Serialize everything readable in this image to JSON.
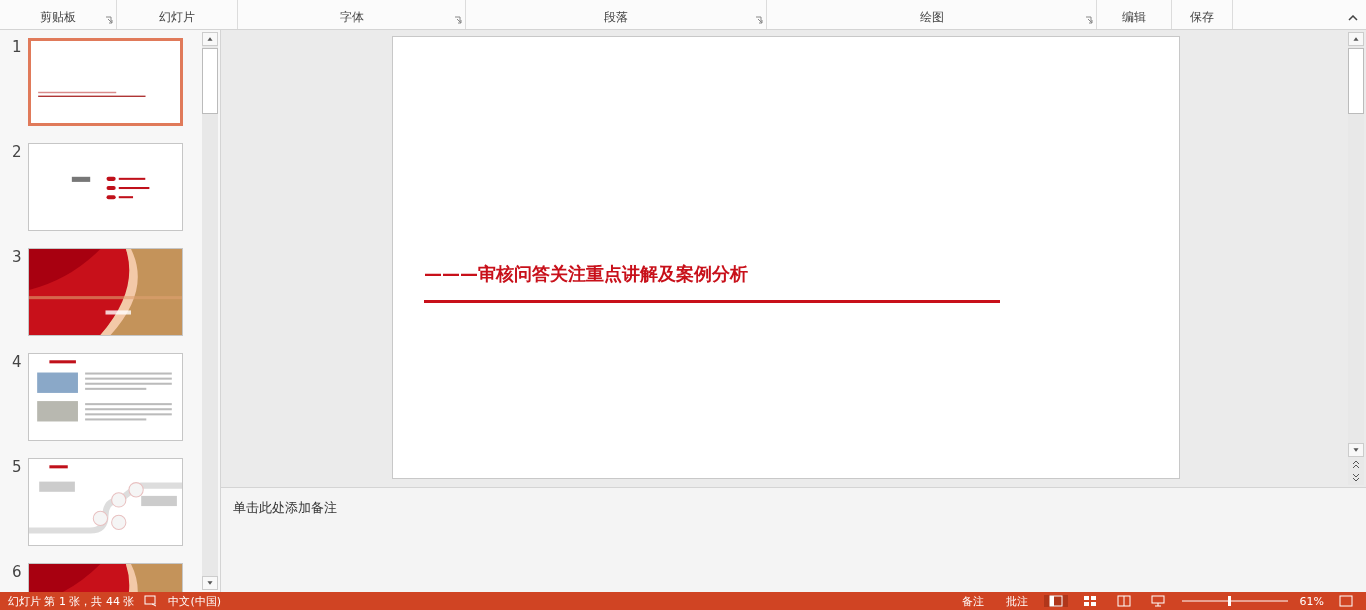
{
  "ribbon": {
    "groups": [
      {
        "label": "剪贴板",
        "launcher": true
      },
      {
        "label": "幻灯片",
        "launcher": false
      },
      {
        "label": "字体",
        "launcher": true
      },
      {
        "label": "段落",
        "launcher": true
      },
      {
        "label": "绘图",
        "launcher": true
      },
      {
        "label": "编辑",
        "launcher": false
      },
      {
        "label": "保存",
        "launcher": false
      }
    ]
  },
  "thumbnails": [
    {
      "number": "1",
      "selected": true,
      "kind": "title"
    },
    {
      "number": "2",
      "selected": false,
      "kind": "toc"
    },
    {
      "number": "3",
      "selected": false,
      "kind": "picture"
    },
    {
      "number": "4",
      "selected": false,
      "kind": "content"
    },
    {
      "number": "5",
      "selected": false,
      "kind": "process"
    },
    {
      "number": "6",
      "selected": false,
      "kind": "picture"
    }
  ],
  "slide": {
    "title": "———审核问答关注重点讲解及案例分析"
  },
  "notes": {
    "placeholder": "单击此处添加备注"
  },
  "status_bar": {
    "slide_info": "幻灯片 第 1 张，共 44 张",
    "language": "中文(中国)",
    "notes_button": "备注",
    "comments_button": "批注",
    "zoom": "61%"
  }
}
